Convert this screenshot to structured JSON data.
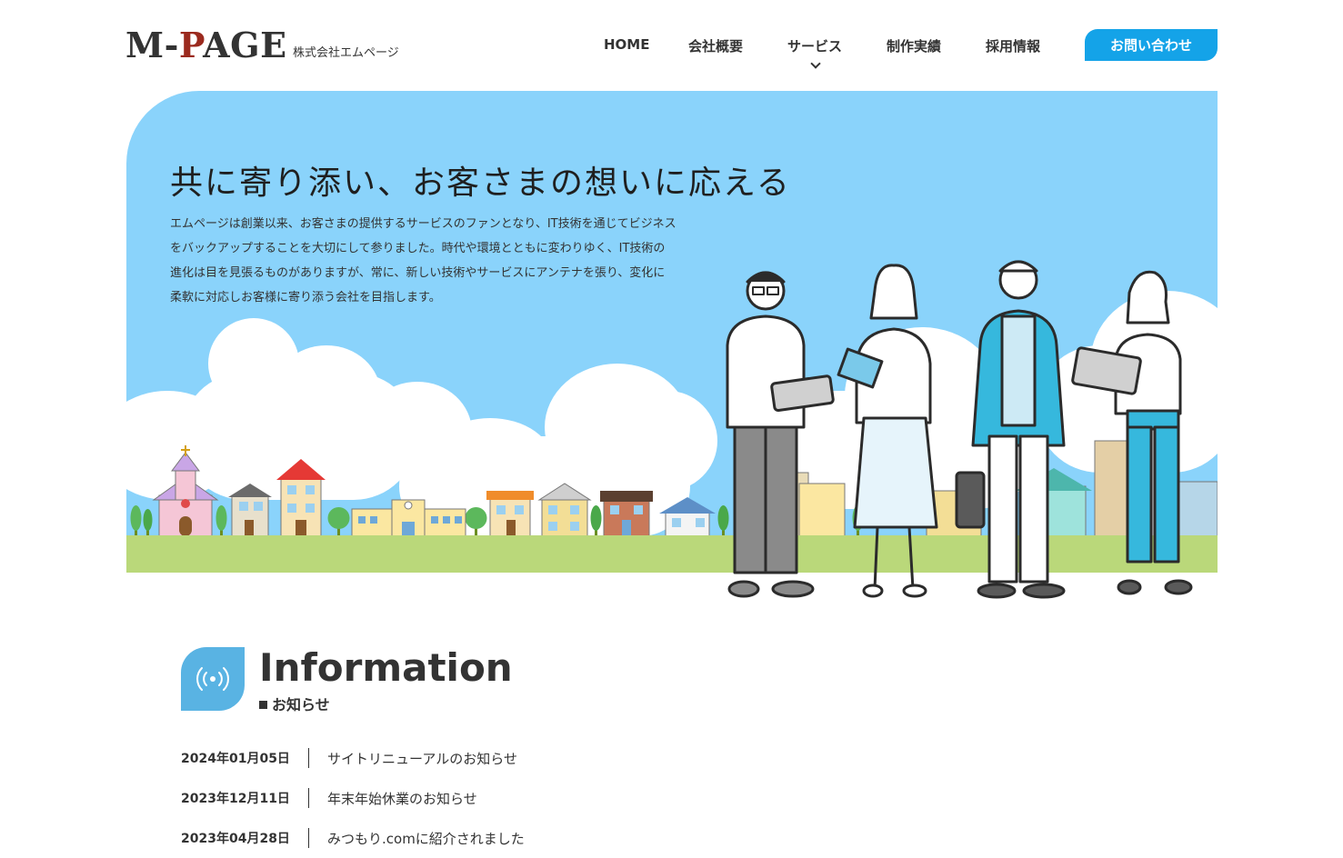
{
  "header": {
    "logo_left": "M-",
    "logo_accent": "P",
    "logo_right": "AGE",
    "company_name": "株式会社エムページ",
    "nav": {
      "home": "HOME",
      "about": "会社概要",
      "service": "サービス",
      "works": "制作実績",
      "recruit": "採用情報"
    },
    "contact": "お問い合わせ"
  },
  "hero": {
    "title": "共に寄り添い、お客さまの想いに応える",
    "lines": [
      "エムページは創業以来、お客さまの提供するサービスのファンとなり、IT技術を通じてビジネス",
      "をバックアップすることを大切にして参りました。時代や環境とともに変わりゆく、IT技術の",
      "進化は目を見張るものがありますが、常に、新しい技術やサービスにアンテナを張り、変化に",
      "柔軟に対応しお客様に寄り添う会社を目指します。"
    ]
  },
  "info": {
    "title": "Information",
    "subtitle": "お知らせ",
    "icon": "broadcast-icon",
    "items": [
      {
        "date": "2024年01月05日",
        "title": "サイトリニューアルのお知らせ"
      },
      {
        "date": "2023年12月11日",
        "title": "年末年始休業のお知らせ"
      },
      {
        "date": "2023年04月28日",
        "title": "みつもり.comに紹介されました"
      }
    ]
  },
  "colors": {
    "accent": "#14a3e8",
    "sky": "#8ad3fb",
    "ground": "#bad87a",
    "logo_accent": "#9b2a1e",
    "info_icon": "#59b3e3"
  }
}
